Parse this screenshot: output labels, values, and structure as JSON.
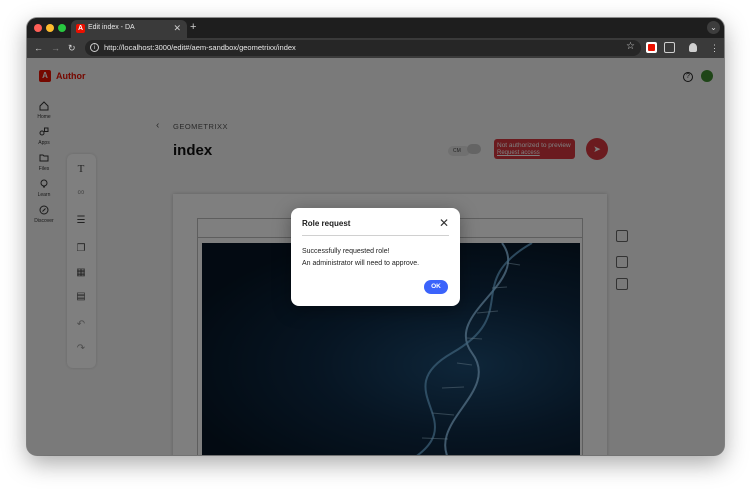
{
  "browser": {
    "tab_title": "Edit index - DA",
    "url": "http://localhost:3000/edit#/aem-sandbox/geometrixx/index"
  },
  "app": {
    "brand": "Author",
    "rail": [
      {
        "label": "Home",
        "icon": "home-icon"
      },
      {
        "label": "Apps",
        "icon": "apps-icon"
      },
      {
        "label": "Files",
        "icon": "folder-icon"
      },
      {
        "label": "Learn",
        "icon": "lightbulb-icon"
      },
      {
        "label": "Discover",
        "icon": "compass-icon"
      }
    ],
    "tools": [
      "T",
      "link-icon",
      "list-icon",
      "copy-icon",
      "table-icon",
      "block-icon",
      "undo-icon",
      "redo-icon"
    ]
  },
  "document": {
    "breadcrumb": "GEOMETRIXX",
    "title": "index",
    "toggle_label": "CM",
    "auth_title": "Not authorized to preview",
    "auth_link": "Request access"
  },
  "modal": {
    "title": "Role request",
    "line1": "Successfully requested role!",
    "line2": "An administrator will need to approve.",
    "ok_label": "OK"
  },
  "colors": {
    "accent": "#3b63fb",
    "brand": "#eb1000",
    "danger": "#d7373f"
  }
}
